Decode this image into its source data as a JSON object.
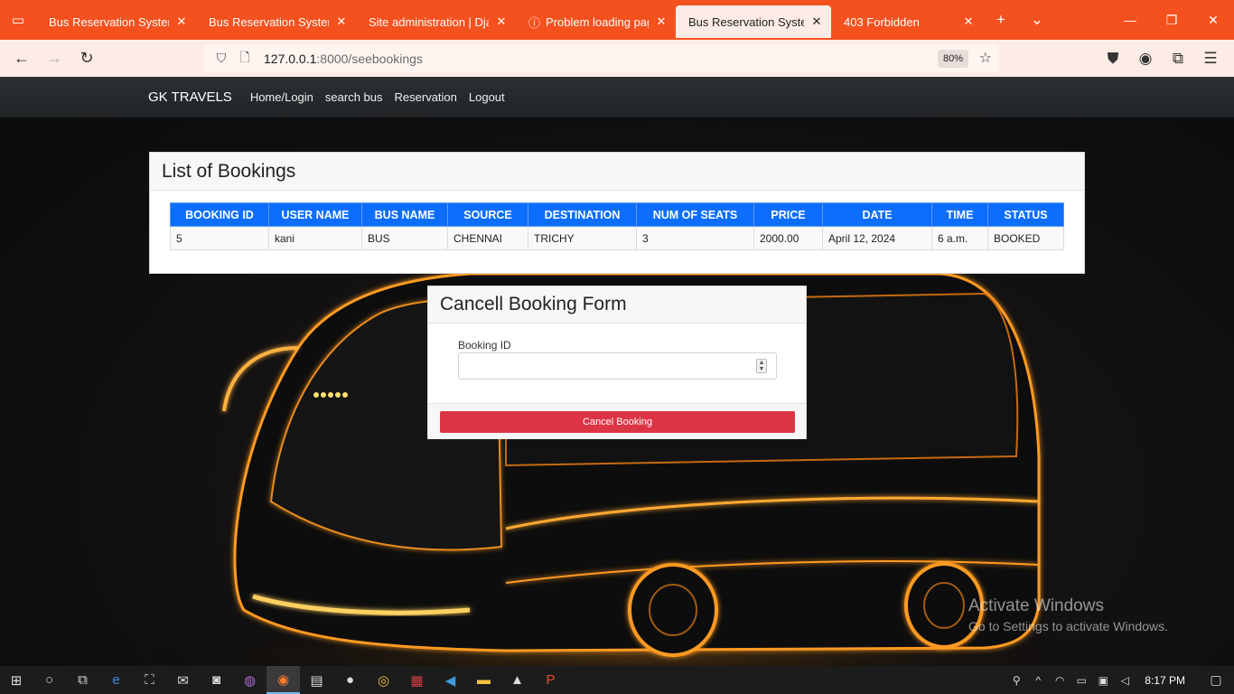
{
  "browser": {
    "tabs": [
      {
        "label": "Bus Reservation System in",
        "active": false
      },
      {
        "label": "Bus Reservation System in",
        "active": false
      },
      {
        "label": "Site administration | Djang",
        "active": false
      },
      {
        "label": "Problem loading page",
        "active": false
      },
      {
        "label": "Bus Reservation System in",
        "active": true
      },
      {
        "label": "403 Forbidden",
        "active": false
      }
    ],
    "url_host": "127.0.0.1",
    "url_rest": ":8000/seebookings",
    "zoom": "80%"
  },
  "site": {
    "brand": "GK TRAVELS",
    "nav": [
      "Home/Login",
      "search bus",
      "Reservation",
      "Logout"
    ]
  },
  "bookings": {
    "title": "List of Bookings",
    "columns": [
      "BOOKING ID",
      "USER NAME",
      "BUS NAME",
      "SOURCE",
      "DESTINATION",
      "NUM OF SEATS",
      "PRICE",
      "DATE",
      "TIME",
      "STATUS"
    ],
    "rows": [
      [
        "5",
        "kani",
        "BUS",
        "CHENNAI",
        "TRICHY",
        "3",
        "2000.00",
        "April 12, 2024",
        "6 a.m.",
        "BOOKED"
      ]
    ]
  },
  "cancel_form": {
    "title": "Cancell Booking Form",
    "field_label": "Booking ID",
    "field_value": "",
    "button_label": "Cancel Booking"
  },
  "watermark": {
    "line1": "Activate Windows",
    "line2": "Go to Settings to activate Windows."
  },
  "taskbar": {
    "time": "8:17 PM"
  }
}
